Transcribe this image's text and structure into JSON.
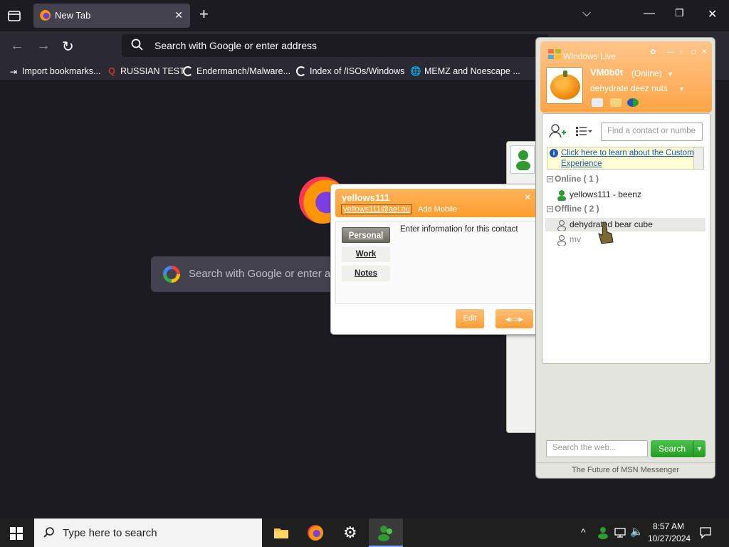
{
  "browser": {
    "tab_title": "New Tab",
    "url_placeholder": "Search with Google or enter address",
    "bookmarks": [
      "Import bookmarks...",
      "RUSSIAN TEST",
      "Endermanch/Malware...",
      "Index of /ISOs/Windows",
      "MEMZ and Noescape ..."
    ],
    "newtab_search_placeholder": "Search with Google or enter ad"
  },
  "contact_card": {
    "name": "yellows111",
    "email": "yellows111@aei.ou",
    "add_mobile": "Add Mobile",
    "tabs": [
      "Personal",
      "Work",
      "Notes"
    ],
    "info_text": "Enter information for this contact",
    "edit_label": "Edit"
  },
  "messenger": {
    "title": "Windows Live",
    "user_name": "VM0b0t",
    "user_status": "(Online)",
    "personal_message": "dehydrate deez nuts",
    "find_placeholder": "Find a contact or numbe",
    "cei_link": "Click here to learn about the Customer Experience",
    "groups": [
      {
        "label": "Online ( 1 )",
        "contacts": [
          "yellows111 - beenz"
        ]
      },
      {
        "label": "Offline ( 2 )",
        "contacts": [
          "dehydrated bear cube",
          "mv"
        ]
      }
    ],
    "web_search_placeholder": "Search the web...",
    "search_button": "Search",
    "footer": "The Future of MSN Messenger"
  },
  "taskbar": {
    "search_placeholder": "Type here to search",
    "time": "8:57 AM",
    "date": "10/27/2024"
  },
  "colors": {
    "accent_orange": "#ffa545",
    "msn_green": "#249c24",
    "browser_dark": "#1c1b22"
  }
}
